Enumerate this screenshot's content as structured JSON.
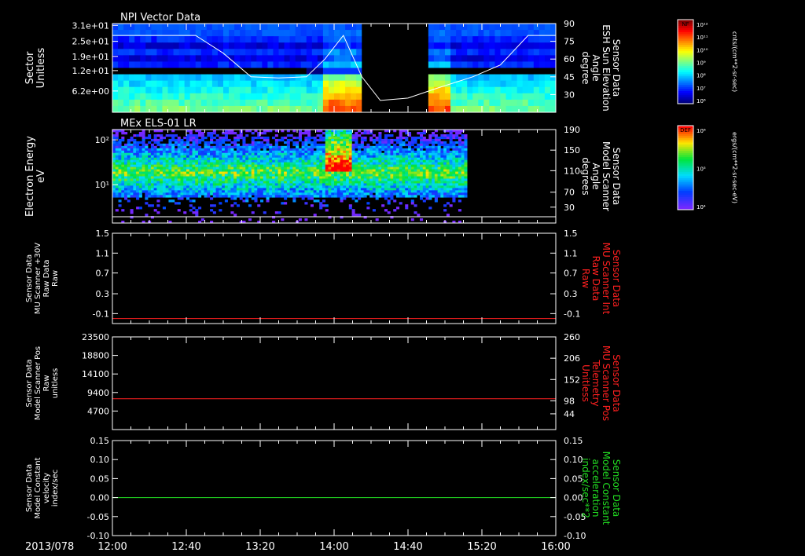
{
  "date_label": "2013/078",
  "time_ticks": [
    "12:00",
    "12:40",
    "13:20",
    "14:00",
    "14:40",
    "15:20",
    "16:00"
  ],
  "time_range": [
    "12:00",
    "16:00"
  ],
  "colors": {
    "background": "#000000",
    "axis": "#ffffff",
    "red_series": "#ff2020",
    "green_series": "#22dd22"
  },
  "panels": [
    {
      "id": "npi",
      "title": "NPI Vector Data",
      "left_label": [
        "Sector",
        "Unitless"
      ],
      "left_ticks": [
        "3.1e+01",
        "2.5e+01",
        "1.9e+01",
        "1.2e+01",
        "6.2e+00"
      ],
      "right_label": [
        "Sensor Data",
        "ESH Sun Elevation",
        "Angle",
        "degree"
      ],
      "right_ticks": [
        "90",
        "75",
        "60",
        "45",
        "30"
      ],
      "colorbar": {
        "label": "NF",
        "units": "cnts/(cm**2-sr-sec)",
        "ticks": [
          "10¹²",
          "10¹¹",
          "10¹⁰",
          "10⁹",
          "10⁸",
          "10⁷",
          "10⁶"
        ]
      }
    },
    {
      "id": "els",
      "title": "MEx ELS-01 LR",
      "left_label": [
        "Electron Energy",
        "eV"
      ],
      "left_ticks": [
        "10²",
        "10¹"
      ],
      "right_label": [
        "Sensor Data",
        "Model Scanner",
        "Angle",
        "degrees"
      ],
      "right_ticks": [
        "190",
        "150",
        "110",
        "70",
        "30"
      ],
      "colorbar": {
        "label": "DEF",
        "units": "ergs/(cm**2-sr-sec-eV)",
        "ticks": [
          "10⁶",
          "10⁵",
          "10⁴"
        ]
      }
    },
    {
      "id": "mu-raw",
      "left_label": [
        "Sensor Data",
        "MU Scanner +30V",
        "Raw Data",
        "Raw"
      ],
      "left_ticks": [
        "1.5",
        "1.1",
        "0.7",
        "0.3",
        "-0.1"
      ],
      "right_label": [
        "Sensor Data",
        "MU Scanner Int",
        "Raw Data",
        "Raw"
      ],
      "right_ticks": [
        "1.5",
        "1.1",
        "0.7",
        "0.3",
        "-0.1"
      ]
    },
    {
      "id": "scanner-pos",
      "left_label": [
        "Sensor Data",
        "Model Scanner Pos",
        "Raw",
        "unitless"
      ],
      "left_ticks": [
        "23500",
        "18800",
        "14100",
        "9400",
        "4700"
      ],
      "right_label": [
        "Sensor Data",
        "MU Scanner Pos",
        "Telemetry",
        "Unitless"
      ],
      "right_ticks": [
        "260",
        "206",
        "152",
        "98",
        "44"
      ]
    },
    {
      "id": "constant",
      "left_label": [
        "Sensor Data",
        "Model Constant",
        "velocity",
        "index/sec"
      ],
      "left_ticks": [
        "0.15",
        "0.10",
        "0.05",
        "0.00",
        "-0.05",
        "-0.10"
      ],
      "right_label": [
        "Sensor Data",
        "Model Constant",
        "acceleration",
        "index/sec**2"
      ],
      "right_ticks": [
        "0.15",
        "0.10",
        "0.05",
        "0.00",
        "-0.05",
        "-0.10"
      ]
    }
  ],
  "chart_data": [
    {
      "type": "heatmap",
      "title": "NPI Vector Data",
      "xlabel": "",
      "ylabel": "Sector Unitless",
      "ylim": [
        0,
        31
      ],
      "data_gap_minutes": [
        135,
        170
      ],
      "line_overlay": {
        "ylabel": "Sensor Data ESH Sun Elevation Angle degree",
        "ylim": [
          15,
          90
        ],
        "x_minutes": [
          0,
          30,
          45,
          60,
          75,
          90,
          105,
          115,
          125,
          135,
          145,
          160,
          175,
          195,
          210,
          225,
          240
        ],
        "values": [
          80,
          80,
          80,
          65,
          45,
          44,
          45,
          60,
          80,
          45,
          25,
          27,
          35,
          45,
          55,
          80,
          80
        ]
      }
    },
    {
      "type": "heatmap",
      "title": "MEx ELS-01 LR",
      "ylabel": "Electron Energy eV",
      "yscale": "log",
      "ylim": [
        2,
        180
      ],
      "data_end_minutes": 192,
      "line_overlay": {
        "ylabel": "Sensor Data Model Scanner Angle degrees",
        "ylim": [
          10,
          190
        ],
        "x_minutes": [
          0,
          240
        ],
        "values": [
          10,
          10
        ]
      }
    },
    {
      "type": "line",
      "ylim": [
        -0.3,
        1.5
      ],
      "series": [
        {
          "name": "Sensor Data MU Scanner Int Raw Data Raw",
          "x_minutes": [
            0,
            240
          ],
          "values": [
            -0.2,
            -0.2
          ]
        }
      ]
    },
    {
      "type": "line",
      "ylim": [
        0,
        23500
      ],
      "series": [
        {
          "name": "Sensor Data MU Scanner Pos Telemetry Unitless",
          "x_minutes": [
            0,
            240
          ],
          "values": [
            7800,
            7800
          ]
        }
      ]
    },
    {
      "type": "line",
      "ylim": [
        -0.1,
        0.15
      ],
      "series": [
        {
          "name": "Sensor Data Model Constant acceleration index/sec**2",
          "x_minutes": [
            0,
            240
          ],
          "values": [
            0.0,
            0.0
          ]
        }
      ]
    }
  ]
}
